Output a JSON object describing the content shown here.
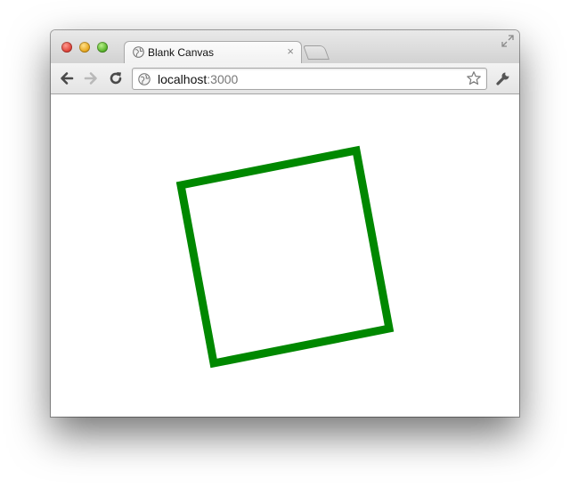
{
  "window": {
    "tab": {
      "title": "Blank Canvas",
      "close_glyph": "×",
      "favicon": "globe-icon"
    },
    "toolbar": {
      "back_icon": "back-arrow-icon",
      "forward_icon": "forward-arrow-icon",
      "reload_icon": "reload-icon",
      "settings_icon": "wrench-icon"
    },
    "address_bar": {
      "host": "localhost",
      "port": ":3000",
      "bookmark_icon": "star-icon"
    }
  },
  "canvas": {
    "shape": "square",
    "stroke_color": "#008800"
  }
}
